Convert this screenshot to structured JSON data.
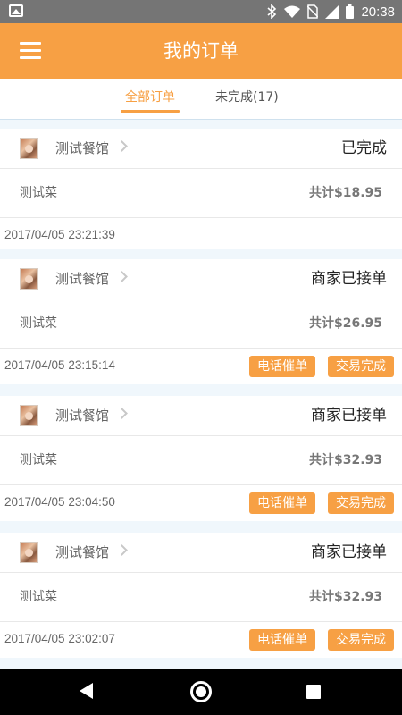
{
  "status_bar": {
    "time": "20:38",
    "icons": [
      "image-icon",
      "bluetooth-icon",
      "wifi-icon",
      "no-sim-icon",
      "signal-icon",
      "battery-icon"
    ]
  },
  "app_bar": {
    "title": "我的订单",
    "menu_icon": "menu-icon"
  },
  "tabs": [
    {
      "label": "全部订单",
      "active": true
    },
    {
      "label": "未完成(17)",
      "active": false
    }
  ],
  "orders": [
    {
      "restaurant": "测试餐馆",
      "status": "已完成",
      "dish": "测试菜",
      "total": "共计$18.95",
      "time": "2017/04/05 23:21:39",
      "buttons": []
    },
    {
      "restaurant": "测试餐馆",
      "status": "商家已接单",
      "dish": "测试菜",
      "total": "共计$26.95",
      "time": "2017/04/05 23:15:14",
      "buttons": [
        "电话催单",
        "交易完成"
      ]
    },
    {
      "restaurant": "测试餐馆",
      "status": "商家已接单",
      "dish": "测试菜",
      "total": "共计$32.93",
      "time": "2017/04/05 23:04:50",
      "buttons": [
        "电话催单",
        "交易完成"
      ]
    },
    {
      "restaurant": "测试餐馆",
      "status": "商家已接单",
      "dish": "测试菜",
      "total": "共计$32.93",
      "time": "2017/04/05 23:02:07",
      "buttons": [
        "电话催单",
        "交易完成"
      ]
    }
  ],
  "colors": {
    "accent": "#f7a044",
    "background": "#f0f7fc",
    "status_bar": "#757575",
    "nav_bar": "#000000"
  },
  "nav_bar": {
    "icons": [
      "back-icon",
      "home-icon",
      "recents-icon"
    ]
  }
}
